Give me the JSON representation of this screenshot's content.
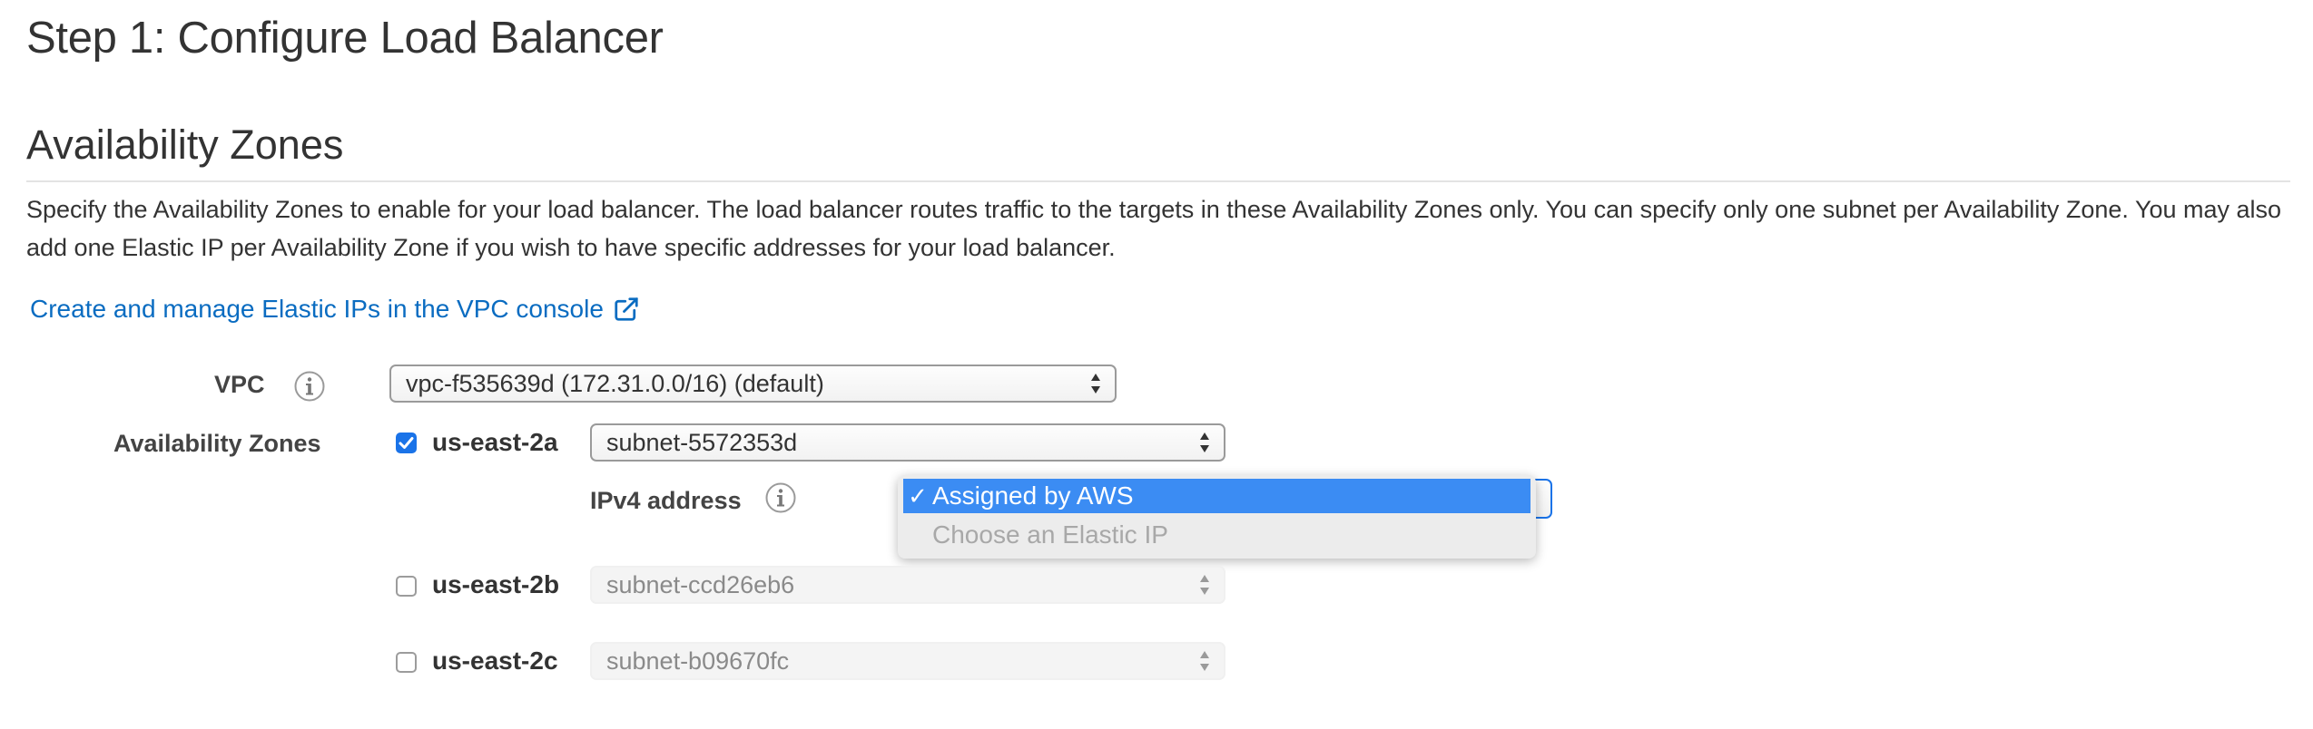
{
  "page": {
    "title": "Step 1: Configure Load Balancer"
  },
  "section": {
    "title": "Availability Zones",
    "description": "Specify the Availability Zones to enable for your load balancer. The load balancer routes traffic to the targets in these Availability Zones only. You can specify only one subnet per Availability Zone. You may also add one Elastic IP per Availability Zone if you wish to have specific addresses for your load balancer.",
    "link_label": "Create and manage Elastic IPs in the VPC console"
  },
  "form": {
    "vpc_label": "VPC",
    "vpc_value": "vpc-f535639d (172.31.0.0/16) (default)",
    "az_label": "Availability Zones",
    "ipv4_label": "IPv4 address",
    "zones": [
      {
        "name": "us-east-2a",
        "checked": true,
        "subnet": "subnet-5572353d"
      },
      {
        "name": "us-east-2b",
        "checked": false,
        "subnet": "subnet-ccd26eb6"
      },
      {
        "name": "us-east-2c",
        "checked": false,
        "subnet": "subnet-b09670fc"
      }
    ]
  },
  "ipv4_dropdown": {
    "options": [
      {
        "label": "Assigned by AWS",
        "selected": true,
        "enabled": true
      },
      {
        "label": "Choose an Elastic IP",
        "selected": false,
        "enabled": false
      }
    ],
    "check_glyph": "✓"
  },
  "icons": {
    "info": "info-circle-icon",
    "external": "external-link-icon",
    "select_arrows": "updown-arrows-icon",
    "checkbox_check": "checkmark-icon"
  },
  "colors": {
    "link": "#0a6cc1",
    "accent": "#1a73e8",
    "dropdown_highlight": "#3b8cf3",
    "text": "#333333",
    "muted": "#8a8a8a"
  }
}
